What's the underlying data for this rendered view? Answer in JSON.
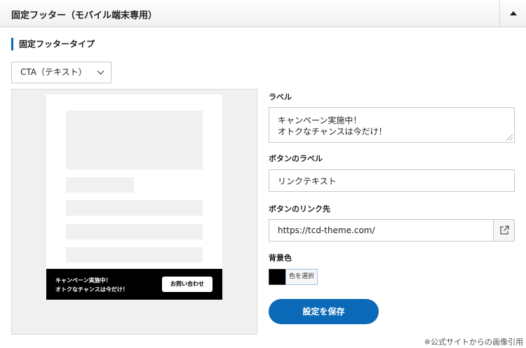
{
  "header": {
    "title": "固定フッター（モバイル端末専用）"
  },
  "section": {
    "title": "固定フッタータイプ"
  },
  "type_select": {
    "value": "CTA（テキスト）"
  },
  "preview": {
    "footer_label": "キャンペーン実施中！\nオトクなチャンスは今だけ！",
    "footer_button": "お問い合わせ"
  },
  "fields": {
    "label": {
      "title": "ラベル",
      "value": "キャンペーン実施中！\nオトクなチャンスは今だけ！"
    },
    "button_label": {
      "title": "ボタンのラベル",
      "value": "リンクテキスト"
    },
    "button_link": {
      "title": "ボタンのリンク先",
      "value": "https://tcd-theme.com/"
    },
    "background": {
      "title": "背景色",
      "color": "#000000",
      "button": "色を選択"
    }
  },
  "save_button": "設定を保存",
  "credit": "※公式サイトからの画像引用",
  "colors": {
    "accent": "#0a6ab8"
  }
}
